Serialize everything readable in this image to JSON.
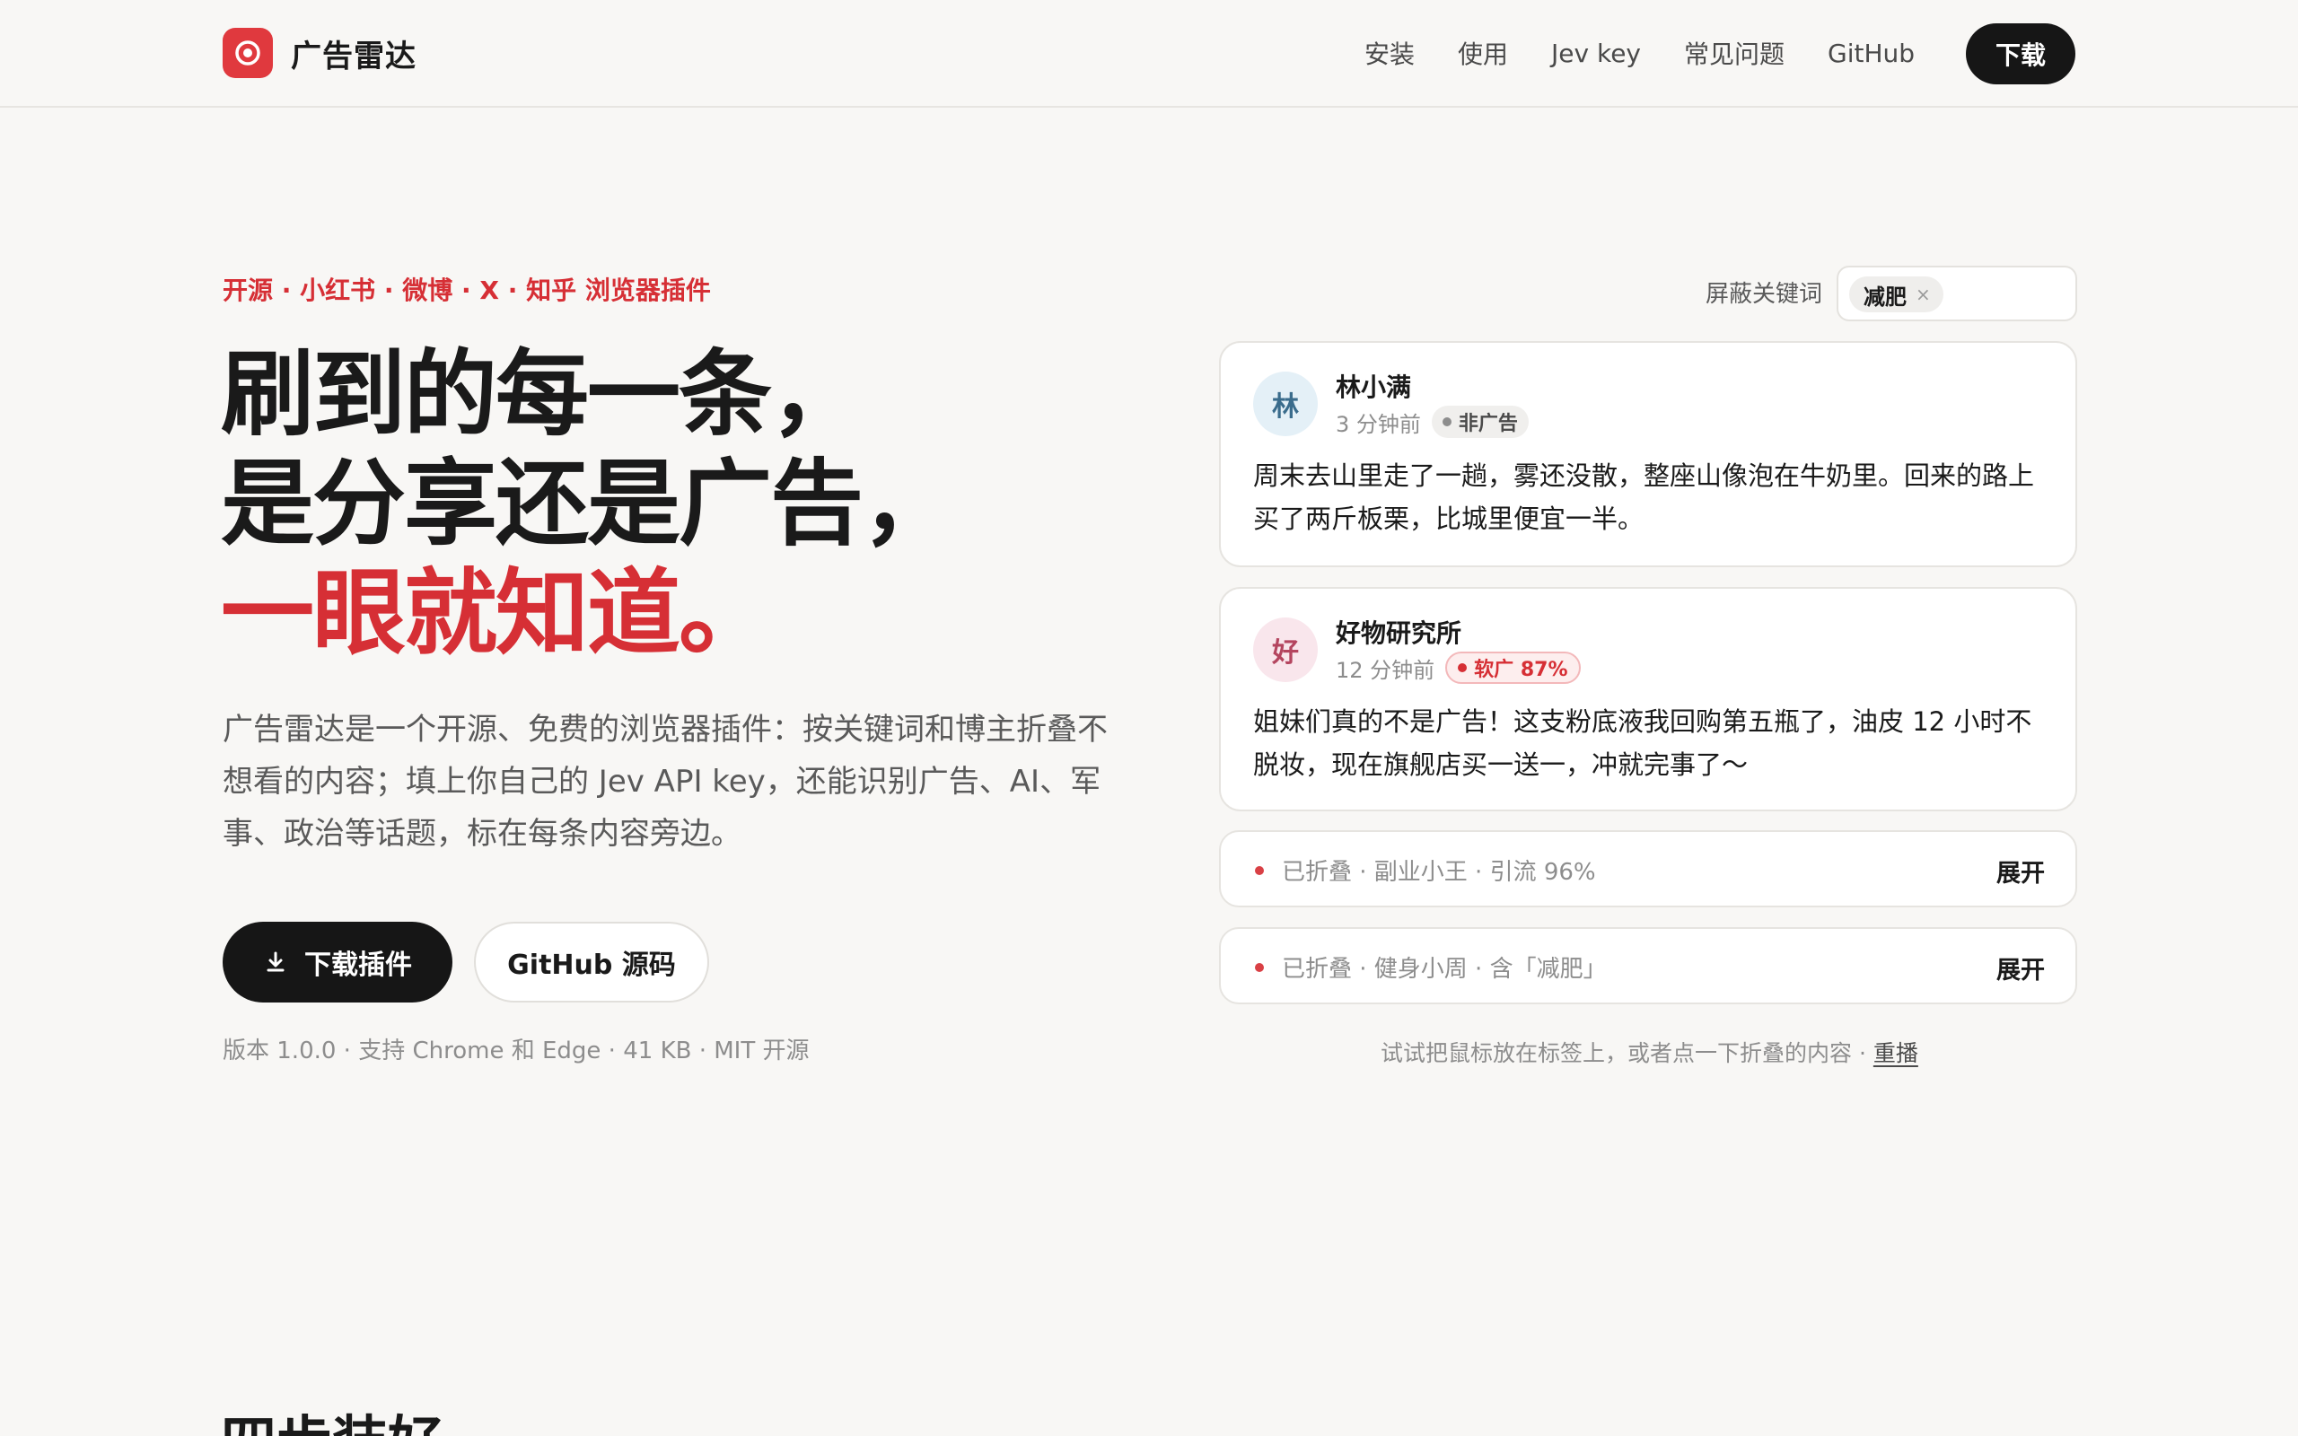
{
  "brand": {
    "name": "广告雷达",
    "logo_icon": "radar-icon",
    "accent": "#e0393e"
  },
  "nav": {
    "items": [
      "安装",
      "使用",
      "Jev key",
      "常见问题",
      "GitHub"
    ],
    "download_label": "下载"
  },
  "hero": {
    "eyebrow": "开源 · 小红书 · 微博 · X · 知乎 浏览器插件",
    "headline_line1": "刷到的每一条，",
    "headline_line2": "是分享还是广告，",
    "headline_line3": "一眼就知道。",
    "lead": "广告雷达是一个开源、免费的浏览器插件：按关键词和博主折叠不想看的内容；填上你自己的 Jev API key，还能识别广告、AI、军事、政治等话题，标在每条内容旁边。",
    "primary_button": "下载插件",
    "secondary_button": "GitHub 源码",
    "meta": "版本 1.0.0 · 支持 Chrome 和 Edge · 41 KB · MIT 开源"
  },
  "demo": {
    "keyword_label": "屏蔽关键词",
    "keywords": [
      "减肥"
    ],
    "posts": [
      {
        "avatar": "林",
        "author": "林小满",
        "time": "3 分钟前",
        "tag": "非广告",
        "text": "周末去山里走了一趟，雾还没散，整座山像泡在牛奶里。回来的路上买了两斤板栗，比城里便宜一半。"
      },
      {
        "avatar": "好",
        "author": "好物研究所",
        "time": "12 分钟前",
        "tag": "软广 87%",
        "text": "姐妹们真的不是广告！这支粉底液我回购第五瓶了，油皮 12 小时不脱妆，现在旗舰店买一送一，冲就完事了～"
      }
    ],
    "folded": [
      {
        "text": "已折叠 · 副业小王 · 引流 96%",
        "action": "展开"
      },
      {
        "text": "已折叠 · 健身小周 · 含「减肥」",
        "action": "展开"
      }
    ],
    "hint": "试试把鼠标放在标签上，或者点一下折叠的内容 · ",
    "replay": "重播"
  },
  "next_section": {
    "title": "四步装好"
  }
}
